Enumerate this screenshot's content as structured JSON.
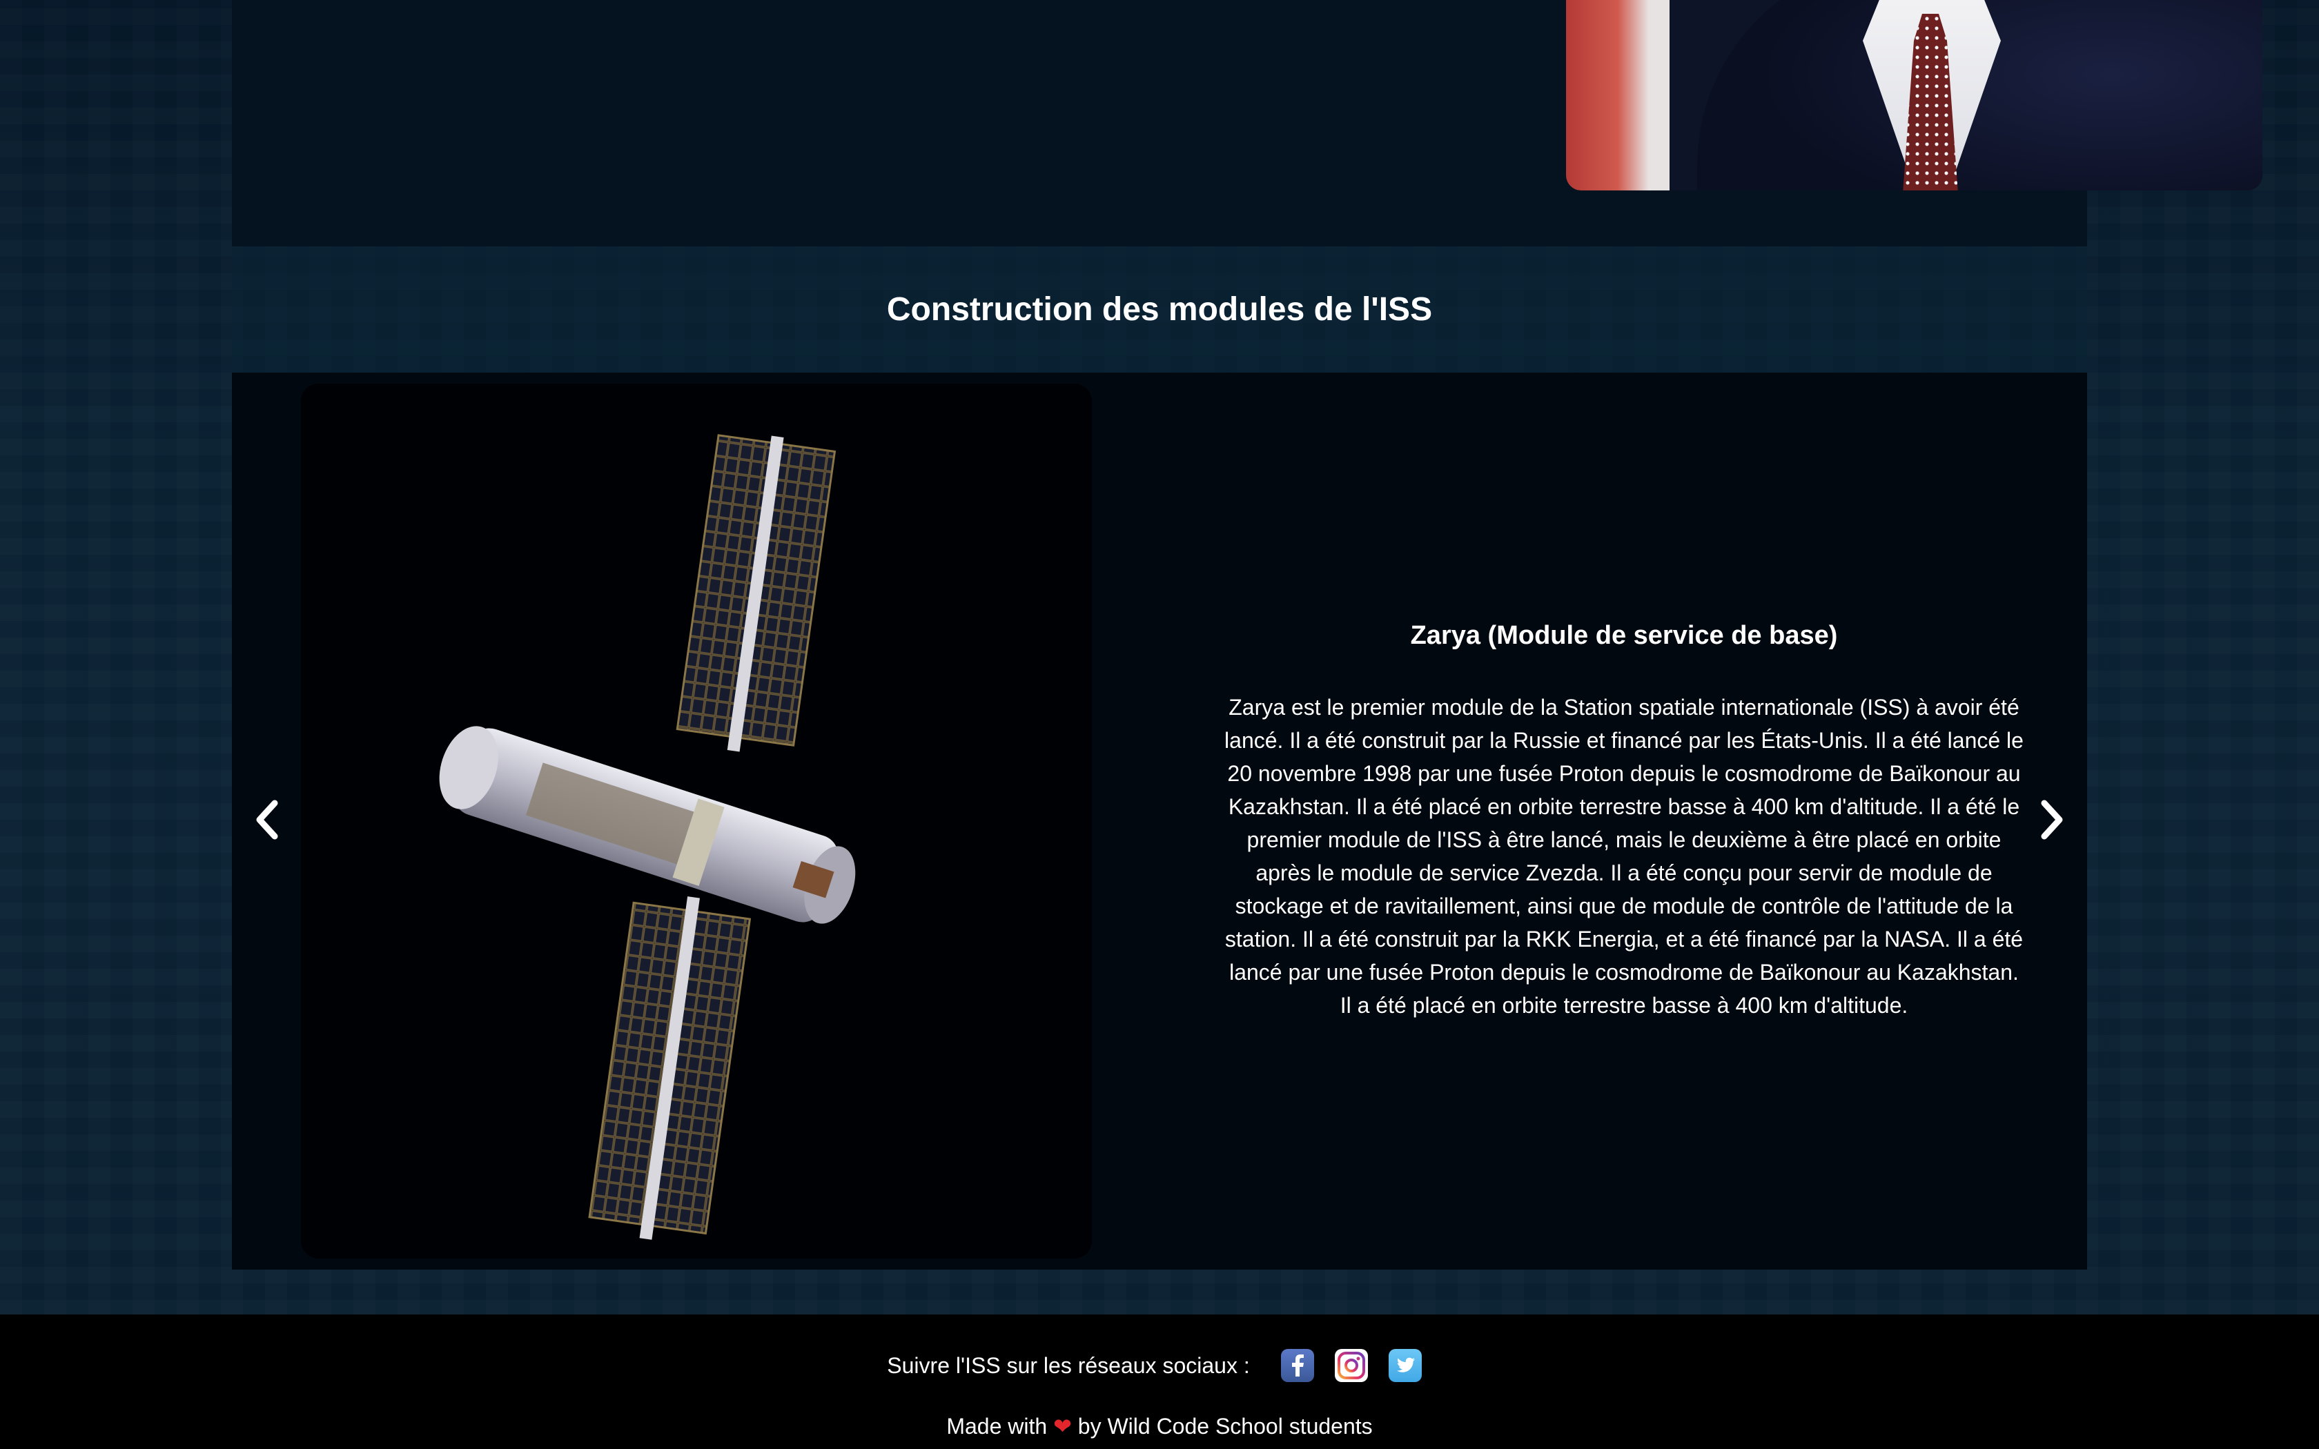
{
  "section": {
    "title": "Construction des modules de l'ISS"
  },
  "carousel": {
    "slide_title": "Zarya (Module de service de base)",
    "slide_description": "Zarya est le premier module de la Station spatiale internationale (ISS) à avoir été lancé. Il a été construit par la Russie et financé par les États-Unis. Il a été lancé le 20 novembre 1998 par une fusée Proton depuis le cosmodrome de Baïkonour au Kazakhstan. Il a été placé en orbite terrestre basse à 400 km d'altitude. Il a été le premier module de l'ISS à être lancé, mais le deuxième à être placé en orbite après le module de service Zvezda. Il a été conçu pour servir de module de stockage et de ravitaillement, ainsi que de module de contrôle de l'attitude de la station. Il a été construit par la RKK Energia, et a été financé par la NASA. Il a été lancé par une fusée Proton depuis le cosmodrome de Baïkonour au Kazakhstan. Il a été placé en orbite terrestre basse à 400 km d'altitude.",
    "prev_icon": "chevron-left-icon",
    "next_icon": "chevron-right-icon"
  },
  "footer": {
    "social_label": "Suivre l'ISS sur les réseaux sociaux :",
    "social_icons": [
      "facebook-icon",
      "instagram-icon",
      "twitter-icon"
    ],
    "made_with_prefix": "Made with",
    "heart": "❤",
    "made_with_suffix": "by Wild Code School students"
  },
  "colors": {
    "page_background": "#0a2234",
    "card_background": "#02080f",
    "footer_background": "#000000",
    "text": "#ffffff",
    "heart": "#e3262c",
    "facebook": "#3b5998",
    "twitter": "#41a8e6"
  }
}
